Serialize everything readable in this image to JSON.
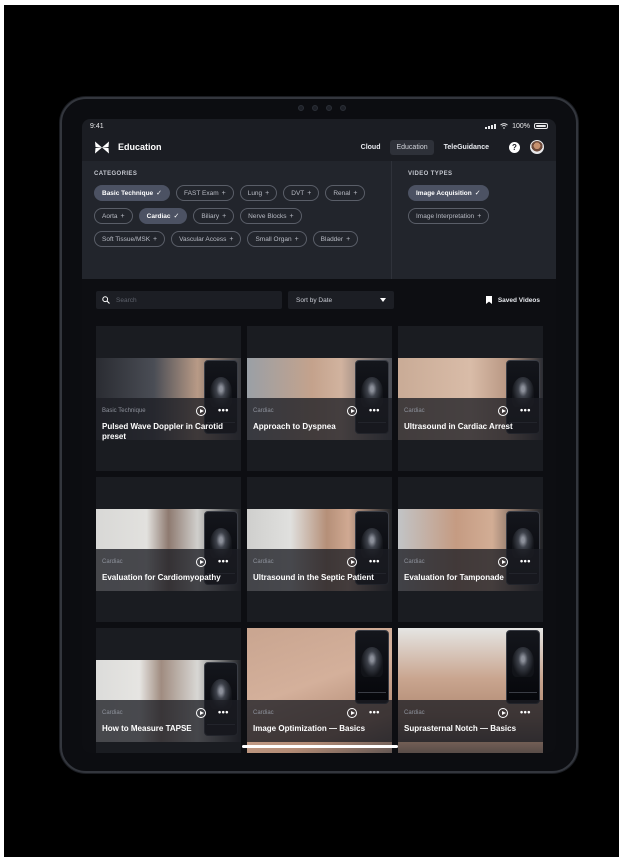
{
  "status": {
    "time": "9:41",
    "battery": "100%"
  },
  "nav": {
    "title": "Education",
    "links": [
      "Cloud",
      "Education",
      "TeleGuidance"
    ],
    "active": "Education"
  },
  "filters": {
    "categories_title": "CATEGORIES",
    "categories_rows": [
      [
        {
          "label": "Basic Technique",
          "selected": true
        },
        {
          "label": "FAST Exam",
          "selected": false
        },
        {
          "label": "Lung",
          "selected": false
        },
        {
          "label": "DVT",
          "selected": false
        },
        {
          "label": "Renal",
          "selected": false
        }
      ],
      [
        {
          "label": "Aorta",
          "selected": false
        },
        {
          "label": "Cardiac",
          "selected": true
        },
        {
          "label": "Biliary",
          "selected": false
        },
        {
          "label": "Nerve Blocks",
          "selected": false
        }
      ],
      [
        {
          "label": "Soft Tissue/MSK",
          "selected": false
        },
        {
          "label": "Vascular Access",
          "selected": false
        },
        {
          "label": "Small Organ",
          "selected": false
        },
        {
          "label": "Bladder",
          "selected": false
        }
      ]
    ],
    "video_types_title": "VIDEO TYPES",
    "video_types": [
      {
        "label": "Image Acquisition",
        "selected": true
      },
      {
        "label": "Image Interpretation",
        "selected": false
      }
    ]
  },
  "toolbar": {
    "search_placeholder": "Search",
    "sort_label": "Sort by Date",
    "saved_label": "Saved Videos"
  },
  "videos": [
    {
      "category": "Basic Technique",
      "title": "Pulsed Wave Doppler in Carotid preset",
      "full": false
    },
    {
      "category": "Cardiac",
      "title": "Approach to Dyspnea",
      "full": false
    },
    {
      "category": "Cardiac",
      "title": "Ultrasound in Cardiac Arrest",
      "full": false
    },
    {
      "category": "Cardiac",
      "title": "Evaluation for Cardiomyopathy",
      "full": false
    },
    {
      "category": "Cardiac",
      "title": "Ultrasound in the Septic Patient",
      "full": false
    },
    {
      "category": "Cardiac",
      "title": "Evaluation for Tamponade",
      "full": false
    },
    {
      "category": "Cardiac",
      "title": "How to Measure TAPSE",
      "full": false
    },
    {
      "category": "Cardiac",
      "title": "Image Optimization — Basics",
      "full": true
    },
    {
      "category": "Cardiac",
      "title": "Suprasternal Notch — Basics",
      "full": true
    }
  ],
  "colors": {
    "accent_chip": "#4c5263",
    "background": "#0d0e12",
    "panel": "#22252c"
  }
}
